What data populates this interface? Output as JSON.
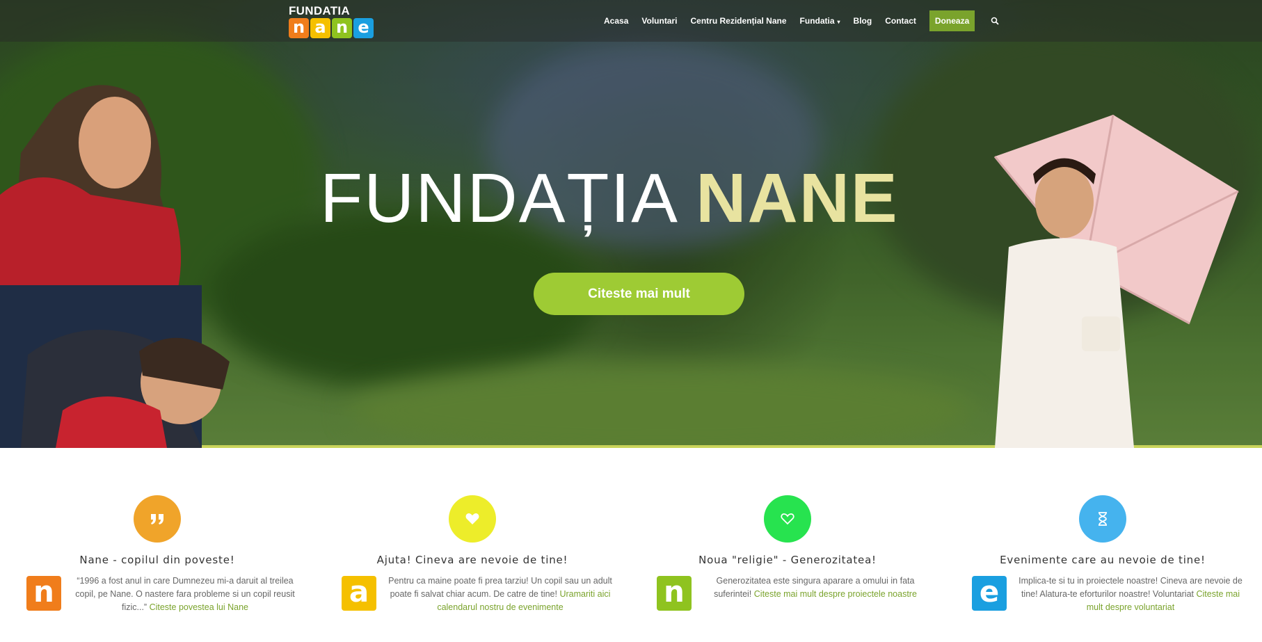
{
  "nav": {
    "logo": {
      "word": "FUNDATIA",
      "letters": [
        "n",
        "a",
        "n",
        "e"
      ],
      "letter_colors": [
        "#f07d1b",
        "#f5c000",
        "#8fc31f",
        "#1a9fe0"
      ]
    },
    "items": [
      "Acasa",
      "Voluntari",
      "Centru Rezidențial Nane",
      "Fundatia",
      "Blog",
      "Contact"
    ],
    "donate_label": "Doneaza",
    "search_icon": "search-icon"
  },
  "hero": {
    "title_main": "FUNDAȚIA",
    "title_accent": "NANE",
    "cta_label": "Citeste mai mult"
  },
  "features": [
    {
      "icon": "quote-icon",
      "icon_color": "#f0a42a",
      "title": "Nane - copilul din poveste!",
      "letter": "n",
      "letter_color": "#f07d1b",
      "text": "“1996 a fost anul in care Dumnezeu mi-a daruit al treilea copil, pe Nane. O nastere fara probleme si un copil reusit fizic...”",
      "link": "Citeste povestea lui Nane"
    },
    {
      "icon": "heart-icon",
      "icon_color": "#eded2a",
      "title": "Ajuta! Cineva are nevoie de tine!",
      "letter": "a",
      "letter_color": "#f5c000",
      "text": "Pentru ca maine poate fi prea tarziu! Un copil sau un adult poate fi salvat chiar acum. De catre de tine!",
      "link": "Uramariti aici calendarul nostru de evenimente"
    },
    {
      "icon": "heart-outline-icon",
      "icon_color": "#27e34f",
      "title": "Noua \"religie\" - Generozitatea!",
      "letter": "n",
      "letter_color": "#8fc31f",
      "text": "Generozitatea este singura aparare a omului in fata suferintei!",
      "link": "Citeste mai mult despre proiectele noastre"
    },
    {
      "icon": "hourglass-icon",
      "icon_color": "#45b3ee",
      "title": "Evenimente care au nevoie de tine!",
      "letter": "e",
      "letter_color": "#1a9fe0",
      "text": "Implica-te si tu in proiectele noastre! Cineva are nevoie de tine! Alatura-te eforturilor noastre! Voluntariat",
      "link": "Citeste mai mult despre voluntariat"
    }
  ]
}
